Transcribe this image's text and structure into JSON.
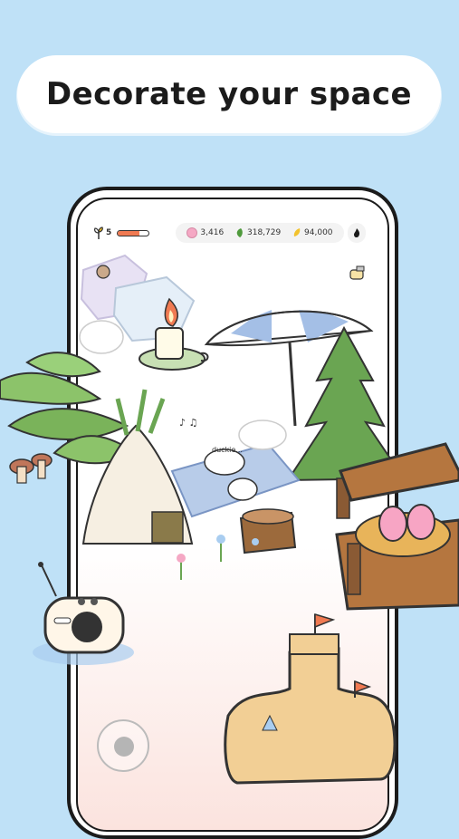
{
  "banner": {
    "title": "Decorate your space"
  },
  "hud": {
    "level": "5",
    "energy_fill": 0.7,
    "currencies": [
      {
        "icon": "pink-gem-icon",
        "value": "3,416",
        "color": "#f5a8c4"
      },
      {
        "icon": "leaf-icon",
        "value": "318,729",
        "color": "#4f9a3c"
      },
      {
        "icon": "coin-icon",
        "value": "94,000",
        "color": "#f2c22c"
      }
    ]
  },
  "scene": {
    "player_name": "duckie..."
  },
  "colors": {
    "background": "#bfe1f7",
    "accent": "#f07a52"
  }
}
